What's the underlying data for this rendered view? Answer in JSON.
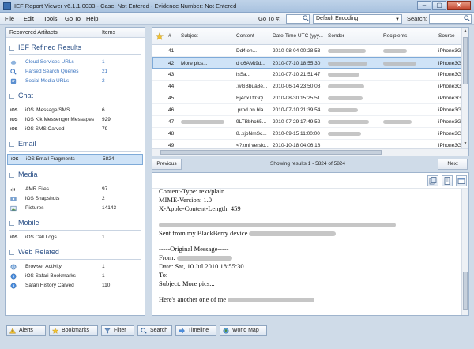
{
  "window": {
    "title": "IEF Report Viewer v6.1.1.0033 - Case: Not Entered - Evidence Number: Not Entered",
    "controls": [
      "–",
      "▢",
      "✕"
    ]
  },
  "menu": {
    "items": [
      "File",
      "Edit",
      "Tools",
      "Go To",
      "Help"
    ],
    "goto_label": "Go To #:",
    "encoding": "Default Encoding",
    "search_label": "Search:"
  },
  "left_panel": {
    "col_artifacts": "Recovered Artifacts",
    "col_items": "Items",
    "groups": [
      {
        "title": "IEF Refined Results",
        "rows": [
          {
            "label": "Cloud Services URLs",
            "count": "1",
            "link": true
          },
          {
            "label": "Parsed Search Queries",
            "count": "21",
            "link": true
          },
          {
            "label": "Social Media URLs",
            "count": "2",
            "link": true
          }
        ]
      },
      {
        "title": "Chat",
        "rows": [
          {
            "label": "iOS iMessage/SMS",
            "count": "6",
            "ios": "iOS"
          },
          {
            "label": "iOS Kik Messenger Messages",
            "count": "929",
            "ios": "iOS"
          },
          {
            "label": "iOS SMS Carved",
            "count": "79",
            "ios": "iOS"
          }
        ]
      },
      {
        "title": "Email",
        "rows": [
          {
            "label": "iOS Email Fragments",
            "count": "5824",
            "ios": "iOS",
            "selected": true
          }
        ]
      },
      {
        "title": "Media",
        "rows": [
          {
            "label": "AMR Files",
            "count": "97"
          },
          {
            "label": "iOS Snapshots",
            "count": "2"
          },
          {
            "label": "Pictures",
            "count": "14143"
          }
        ]
      },
      {
        "title": "Mobile",
        "rows": [
          {
            "label": "iOS Call Logs",
            "count": "1",
            "ios": "iOS"
          }
        ]
      },
      {
        "title": "Web Related",
        "rows": [
          {
            "label": "Browser Activity",
            "count": "1"
          },
          {
            "label": "iOS Safari Bookmarks",
            "count": "1"
          },
          {
            "label": "Safari History Carved",
            "count": "110"
          }
        ]
      }
    ]
  },
  "grid": {
    "headers": [
      "#",
      "Subject",
      "Content",
      "Date-Time UTC (yyy...",
      "Sender",
      "Recipients",
      "Source"
    ],
    "rows": [
      {
        "num": "41",
        "subject": "",
        "content": "Dd4len...",
        "date": "2010-08-04 00:28:53",
        "source": "iPhone3G..."
      },
      {
        "num": "42",
        "subject": "More pics...",
        "content": "d o6AMt9d...",
        "date": "2010-07-10 18:55:30",
        "source": "iPhone3G...",
        "selected": true
      },
      {
        "num": "43",
        "subject": "",
        "content": "lsSa...",
        "date": "2010-07-10 21:51:47",
        "source": "iPhone3G..."
      },
      {
        "num": "44",
        "subject": "",
        "content": ".wGBbua8e...",
        "date": "2010-06-14 23:50:08",
        "source": "iPhone3G..."
      },
      {
        "num": "45",
        "subject": "",
        "content": "Bj4oxTftGQ...",
        "date": "2010-08-30 15:25:51",
        "source": "iPhone3G..."
      },
      {
        "num": "46",
        "subject": "",
        "content": ".prod.on.bla...",
        "date": "2010-07-10 21:39:54",
        "source": "iPhone3G..."
      },
      {
        "num": "47",
        "subject": "",
        "content": "9LTBbhc65...",
        "date": "2010-07-29 17:49:52",
        "source": "iPhone3G..."
      },
      {
        "num": "48",
        "subject": "",
        "content": "8..xjbNmSc...",
        "date": "2010-09-15 11:00:00",
        "source": "iPhone3G..."
      },
      {
        "num": "49",
        "subject": "",
        "content": "<?xml versio...",
        "date": "2010-10-18 04:06:18",
        "source": "iPhone3G..."
      }
    ]
  },
  "pager": {
    "previous": "Previous",
    "next": "Next",
    "status": "Showing results 1 - 5824 of 5824"
  },
  "preview": {
    "lines": [
      "Content-Type: text/plain",
      "MIME-Version: 1.0",
      "X-Apple-Content-Length: 459",
      "",
      "",
      "Sent from my BlackBerry device",
      "",
      "-----Original Message-----",
      "From:",
      "Date: Sat, 10 Jul 2010 18:55:30",
      "To:",
      "Subject: More pics...",
      "",
      "Here's another one of me"
    ]
  },
  "bottom_bar": {
    "buttons": [
      "Alerts",
      "Bookmarks",
      "Filter",
      "Search",
      "Timeline",
      "World Map"
    ]
  },
  "colors": {
    "background": "#cfdbe8",
    "selection": "#cfe3f7",
    "group_title": "#2a4f86",
    "link": "#3a74c0"
  }
}
